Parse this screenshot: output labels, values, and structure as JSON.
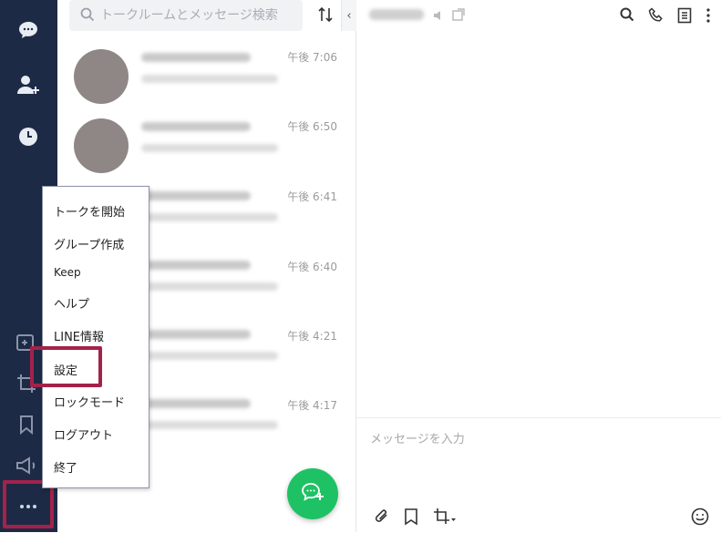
{
  "search": {
    "placeholder": "トークルームとメッセージ検索"
  },
  "chat_list": [
    {
      "time": "午後 7:06"
    },
    {
      "time": "午後 6:50"
    },
    {
      "time": "午後 6:41"
    },
    {
      "time": "午後 6:40"
    },
    {
      "time": "午後 4:21"
    },
    {
      "time": "午後 4:17"
    }
  ],
  "menu": {
    "items": [
      "トークを開始",
      "グループ作成",
      "Keep",
      "ヘルプ",
      "LINE情報",
      "設定",
      "ロックモード",
      "ログアウト",
      "終了"
    ]
  },
  "composer": {
    "placeholder": "メッセージを入力"
  },
  "colors": {
    "rail": "#1d2a45",
    "accent_green": "#1ec264",
    "highlight": "#a3224a"
  },
  "icons": {
    "rail": [
      "chat-icon",
      "add-friend-icon",
      "clock-icon",
      "add-image-icon",
      "crop-icon",
      "bookmark-icon",
      "megaphone-icon",
      "more-icon"
    ],
    "chat_header": [
      "mute-icon",
      "external-window-icon",
      "search-icon",
      "phone-icon",
      "notes-icon",
      "kebab-menu-icon"
    ],
    "composer": [
      "attach-icon",
      "bookmark-icon",
      "crop-icon",
      "emoji-icon"
    ]
  }
}
